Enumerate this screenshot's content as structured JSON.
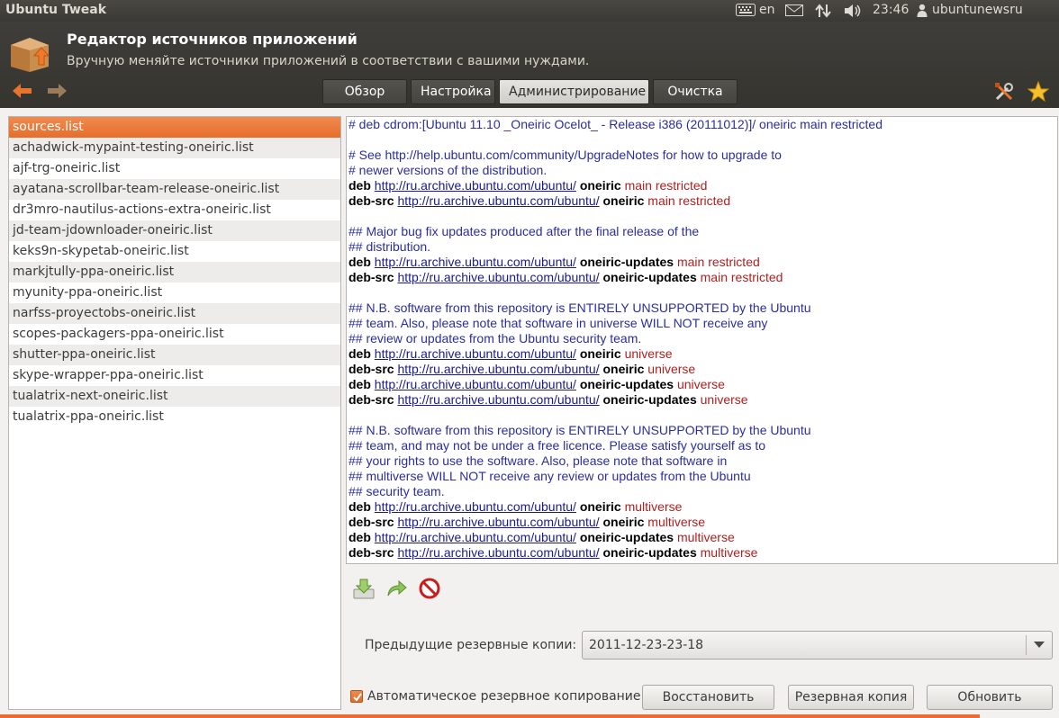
{
  "topbar": {
    "app_name": "Ubuntu Tweak",
    "keyboard_layout": "en",
    "time": "23:46",
    "user": "ubuntunewsru",
    "icons": [
      "keyboard-icon",
      "mail-icon",
      "network-icon",
      "volume-icon",
      "user-icon"
    ]
  },
  "header": {
    "title": "Редактор источников приложений",
    "subtitle": "Вручную меняйте источники приложений в соответствии с вашими нуждами.",
    "tabs": [
      {
        "label": "Обзор",
        "active": false
      },
      {
        "label": "Настройка",
        "active": false
      },
      {
        "label": "Администрирование",
        "active": true
      },
      {
        "label": "Очистка",
        "active": false
      }
    ],
    "accent_color": "#e76e2c"
  },
  "files": [
    "sources.list",
    "achadwick-mypaint-testing-oneiric.list",
    "ajf-trg-oneiric.list",
    "ayatana-scrollbar-team-release-oneiric.list",
    "dr3mro-nautilus-actions-extra-oneiric.list",
    "jd-team-jdownloader-oneiric.list",
    "keks9n-skypetab-oneiric.list",
    "markjtully-ppa-oneiric.list",
    "myunity-ppa-oneiric.list",
    "narfss-proyectobs-oneiric.list",
    "scopes-packagers-ppa-oneiric.list",
    "shutter-ppa-oneiric.list",
    "skype-wrapper-ppa-oneiric.list",
    "tualatrix-next-oneiric.list",
    "tualatrix-ppa-oneiric.list"
  ],
  "selected_file_index": 0,
  "editor_lines": [
    {
      "type": "comment",
      "text": "# deb cdrom:[Ubuntu 11.10 _Oneiric Ocelot_ - Release i386 (20111012)]/ oneiric main restricted"
    },
    {
      "type": "blank"
    },
    {
      "type": "comment",
      "text": "# See http://help.ubuntu.com/community/UpgradeNotes for how to upgrade to"
    },
    {
      "type": "comment",
      "text": "# newer versions of the distribution."
    },
    {
      "type": "src",
      "kw": "deb",
      "url": "http://ru.archive.ubuntu.com/ubuntu/",
      "dist": "oneiric",
      "comp": "main restricted"
    },
    {
      "type": "src",
      "kw": "deb-src",
      "url": "http://ru.archive.ubuntu.com/ubuntu/",
      "dist": "oneiric",
      "comp": "main restricted"
    },
    {
      "type": "blank"
    },
    {
      "type": "comment",
      "text": "## Major bug fix updates produced after the final release of the"
    },
    {
      "type": "comment",
      "text": "## distribution."
    },
    {
      "type": "src",
      "kw": "deb",
      "url": "http://ru.archive.ubuntu.com/ubuntu/",
      "dist": "oneiric-updates",
      "comp": "main restricted"
    },
    {
      "type": "src",
      "kw": "deb-src",
      "url": "http://ru.archive.ubuntu.com/ubuntu/",
      "dist": "oneiric-updates",
      "comp": "main restricted"
    },
    {
      "type": "blank"
    },
    {
      "type": "comment",
      "text": "## N.B. software from this repository is ENTIRELY UNSUPPORTED by the Ubuntu"
    },
    {
      "type": "comment",
      "text": "## team. Also, please note that software in universe WILL NOT receive any"
    },
    {
      "type": "comment",
      "text": "## review or updates from the Ubuntu security team."
    },
    {
      "type": "src",
      "kw": "deb",
      "url": "http://ru.archive.ubuntu.com/ubuntu/",
      "dist": "oneiric",
      "comp": "universe"
    },
    {
      "type": "src",
      "kw": "deb-src",
      "url": "http://ru.archive.ubuntu.com/ubuntu/",
      "dist": "oneiric",
      "comp": "universe"
    },
    {
      "type": "src",
      "kw": "deb",
      "url": "http://ru.archive.ubuntu.com/ubuntu/",
      "dist": "oneiric-updates",
      "comp": "universe"
    },
    {
      "type": "src",
      "kw": "deb-src",
      "url": "http://ru.archive.ubuntu.com/ubuntu/",
      "dist": "oneiric-updates",
      "comp": "universe"
    },
    {
      "type": "blank"
    },
    {
      "type": "comment",
      "text": "## N.B. software from this repository is ENTIRELY UNSUPPORTED by the Ubuntu"
    },
    {
      "type": "comment",
      "text": "## team, and may not be under a free licence. Please satisfy yourself as to"
    },
    {
      "type": "comment",
      "text": "## your rights to use the software. Also, please note that software in"
    },
    {
      "type": "comment",
      "text": "## multiverse WILL NOT receive any review or updates from the Ubuntu"
    },
    {
      "type": "comment",
      "text": "## security team."
    },
    {
      "type": "src",
      "kw": "deb",
      "url": "http://ru.archive.ubuntu.com/ubuntu/",
      "dist": "oneiric",
      "comp": "multiverse"
    },
    {
      "type": "src",
      "kw": "deb-src",
      "url": "http://ru.archive.ubuntu.com/ubuntu/",
      "dist": "oneiric",
      "comp": "multiverse"
    },
    {
      "type": "src",
      "kw": "deb",
      "url": "http://ru.archive.ubuntu.com/ubuntu/",
      "dist": "oneiric-updates",
      "comp": "multiverse"
    },
    {
      "type": "src",
      "kw": "deb-src",
      "url": "http://ru.archive.ubuntu.com/ubuntu/",
      "dist": "oneiric-updates",
      "comp": "multiverse"
    }
  ],
  "backups": {
    "label": "Предыдущие резервные копии:",
    "selected": "2011-12-23-23-18"
  },
  "bottom": {
    "auto_backup_label": "Автоматическое резервное копирование",
    "auto_backup_checked": true,
    "restore_label": "Восстановить",
    "backup_label": "Резервная копия",
    "refresh_label": "Обновить"
  }
}
